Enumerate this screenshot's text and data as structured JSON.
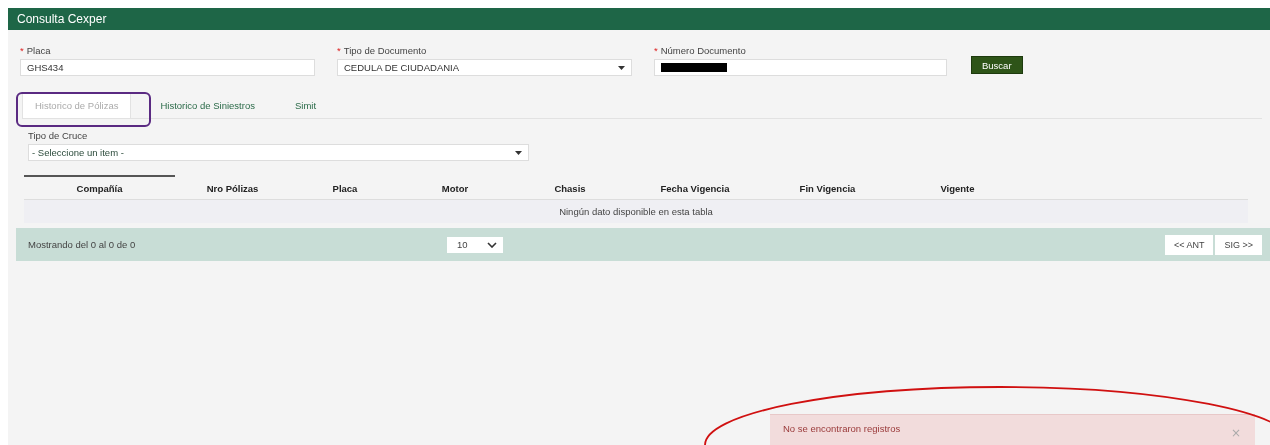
{
  "window": {
    "title": "Consulta Cexper"
  },
  "fields": [
    {
      "kind": "text",
      "label": "Placa",
      "required_mark": "*",
      "value": "GHS434",
      "redacted": false
    },
    {
      "kind": "select",
      "label": "Tipo de Documento",
      "required_mark": "*",
      "value": "CEDULA DE CIUDADANIA",
      "redacted": false
    },
    {
      "kind": "text",
      "label": "Número Documento",
      "required_mark": "*",
      "redacted": true
    }
  ],
  "search_button": "Buscar",
  "tabs": [
    {
      "label": "Historico de Pólizas",
      "selected": true
    },
    {
      "label": "Historico de Siniestros",
      "selected": false
    },
    {
      "label": "Simit",
      "selected": false
    }
  ],
  "filter": {
    "label": "Tipo de Cruce",
    "value": "- Seleccione un item -"
  },
  "table": {
    "columns": [
      {
        "label": "Compañía",
        "sorted": true
      },
      {
        "label": "Nro Pólizas",
        "sorted": false
      },
      {
        "label": "Placa",
        "sorted": false
      },
      {
        "label": "Motor",
        "sorted": false
      },
      {
        "label": "Chasis",
        "sorted": false
      },
      {
        "label": "Fecha Vigencia",
        "sorted": false
      },
      {
        "label": "Fin Vigencia",
        "sorted": false
      },
      {
        "label": "Vigente",
        "sorted": false
      }
    ],
    "empty_message": "Ningún dato disponible en esta tabla"
  },
  "footer": {
    "info": "Mostrando del 0 al 0 de 0",
    "page_size": "10",
    "buttons": [
      "<< ANT",
      "SIG >>"
    ]
  },
  "toast": {
    "message": "No se encontraron registros",
    "close": "×"
  }
}
